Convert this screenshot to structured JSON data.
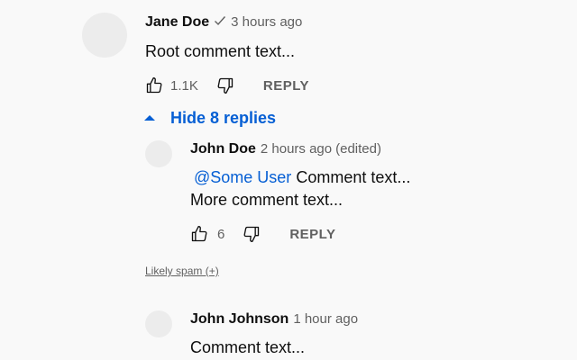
{
  "root_comment": {
    "author": "Jane Doe",
    "verified_icon": "checkmark-icon",
    "timestamp": "3 hours ago",
    "text": "Root comment text...",
    "like_count": "1.1K",
    "reply_label": "REPLY"
  },
  "replies_toggle": {
    "icon": "caret-up-icon",
    "label": "Hide 8 replies"
  },
  "replies": [
    {
      "author": "John Doe",
      "timestamp": "2 hours ago",
      "edited": "(edited)",
      "mention": "@Some User",
      "text_line1": "Comment text...",
      "text_line2": "More comment text...",
      "like_count": "6",
      "reply_label": "REPLY"
    },
    {
      "author": "John Johnson",
      "timestamp": "1 hour ago",
      "text": "Comment text..."
    }
  ],
  "spam_link": "Likely spam (+)",
  "colors": {
    "background": "#f9f9f9",
    "link_blue": "#065fd4",
    "secondary_text": "#606060",
    "avatar": "#ececec"
  }
}
